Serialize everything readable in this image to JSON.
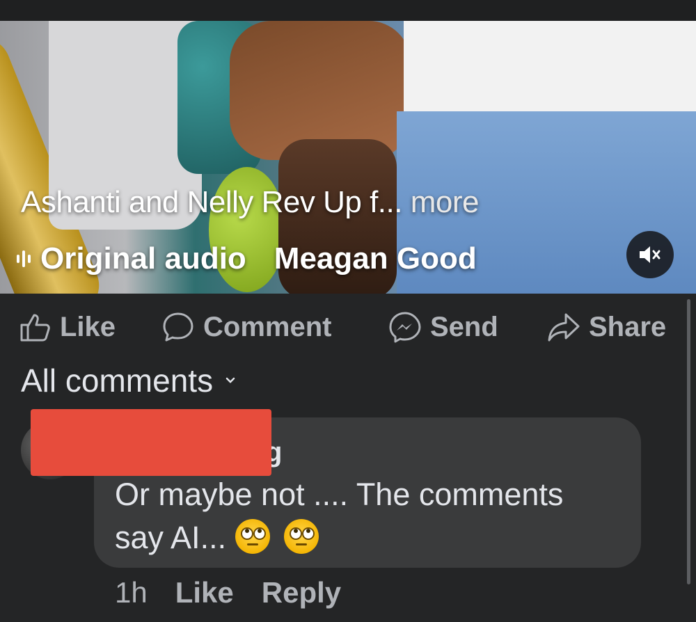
{
  "video": {
    "caption": "Ashanti and Nelly Rev Up f...",
    "more_label": "more",
    "audio_label": "Original audio",
    "audio_artist": "Meagan Good",
    "mute_icon": "speaker-muted-icon"
  },
  "actions": {
    "like": "Like",
    "comment": "Comment",
    "send": "Send",
    "share": "Share"
  },
  "comments_header": {
    "label": "All comments"
  },
  "comment": {
    "author_tail": "g",
    "text_line1": "Or maybe not .... The comments",
    "text_line2": "say AI...",
    "time": "1h",
    "like": "Like",
    "reply": "Reply"
  },
  "colors": {
    "background": "#242526",
    "bubble": "#3a3b3c",
    "redaction": "#e74c3c",
    "secondary_text": "#b0b3b8"
  }
}
